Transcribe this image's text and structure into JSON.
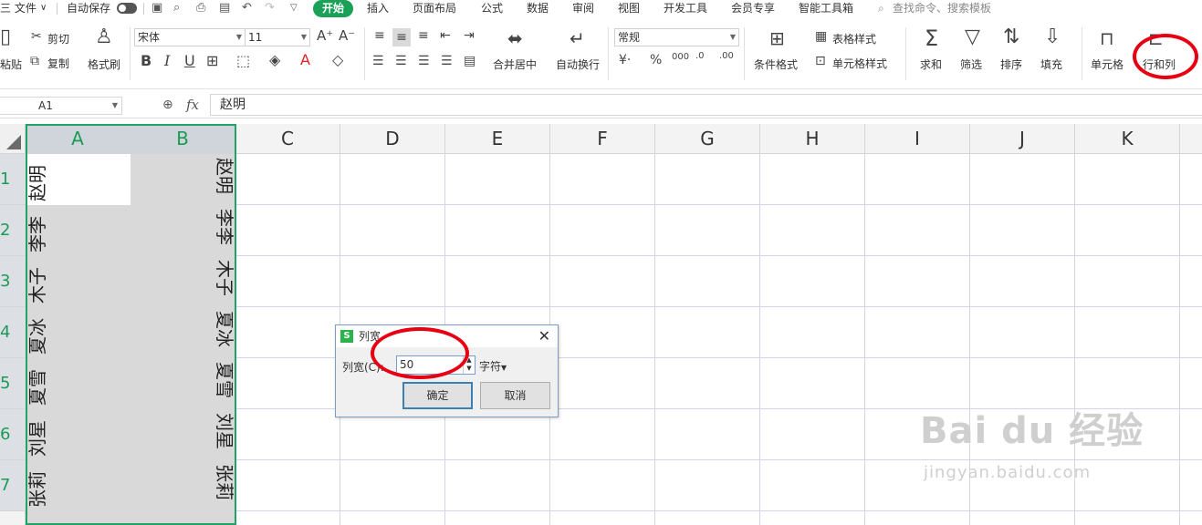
{
  "menubar": {
    "file": "三 文件",
    "autosave": "自动保存",
    "tabs": [
      "开始",
      "插入",
      "页面布局",
      "公式",
      "数据",
      "审阅",
      "视图",
      "开发工具",
      "会员专享",
      "智能工具箱"
    ],
    "search": "查找命令、搜索模板"
  },
  "ribbon": {
    "paste": "粘贴",
    "cut": "剪切",
    "copy": "复制",
    "format_painter": "格式刷",
    "font_name": "宋体",
    "font_size": "11",
    "merge_center": "合并居中",
    "wrap_text": "自动换行",
    "number_format": "常规",
    "conditional_format": "条件格式",
    "table_style": "表格样式",
    "cell_style": "单元格样式",
    "sum": "求和",
    "filter": "筛选",
    "sort": "排序",
    "fill": "填充",
    "cell": "单元格",
    "row_col": "行和列"
  },
  "formula_bar": {
    "name_box": "A1",
    "fx": "fx",
    "content": "赵明"
  },
  "grid": {
    "columns": [
      "A",
      "B",
      "C",
      "D",
      "E",
      "F",
      "G",
      "H",
      "I",
      "J",
      "K"
    ],
    "rows": [
      "1",
      "2",
      "3",
      "4",
      "5",
      "6",
      "7"
    ],
    "col_a": [
      "赵明",
      "李李",
      "木子",
      "夏冰",
      "夏雪",
      "刘星",
      "张莉"
    ],
    "col_b": [
      "赵明",
      "李李",
      "木子",
      "夏冰",
      "夏雪",
      "刘星",
      "张莉"
    ]
  },
  "dialog": {
    "title": "列宽",
    "label": "列宽(C):",
    "value": "50",
    "unit": "字符",
    "ok": "确定",
    "cancel": "取消"
  },
  "watermark": {
    "brand": "Bai du 经验",
    "url": "jingyan.baidu.com"
  },
  "colors": {
    "accent": "#1aa157",
    "selection_border": "#21a366",
    "annotation": "#e60012"
  }
}
